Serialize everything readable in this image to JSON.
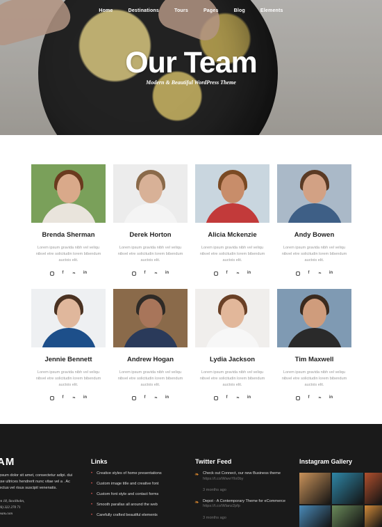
{
  "nav": [
    "Home",
    "Destinations",
    "Tours",
    "Pages",
    "Blog",
    "Elements"
  ],
  "hero": {
    "title": "Our Team",
    "subtitle": "Modern & Beautiful WordPress Theme"
  },
  "team": [
    {
      "name": "Brenda Sherman",
      "bio": "Lorem ipsum gravida nibh vel veliqu nibvel etre solicitudin lorem bibendum auctois elit.",
      "colors": {
        "bg": "#7aa05a",
        "skin": "#d9a98a",
        "hair": "#6a3a1e",
        "shirt": "#e9e4dc"
      }
    },
    {
      "name": "Derek Horton",
      "bio": "Lorem ipsum gravida nibh vel veliqu nibvel etre solicitudin lorem bibendum auctois elit.",
      "colors": {
        "bg": "#ececec",
        "skin": "#d8b197",
        "hair": "#8a6a4a",
        "shirt": "#f4f4f4"
      }
    },
    {
      "name": "Alicia Mckenzie",
      "bio": "Lorem ipsum gravida nibh vel veliqu nibvel etre solicitudin lorem bibendum auctois elit.",
      "colors": {
        "bg": "#c9d6df",
        "skin": "#c88d6a",
        "hair": "#7a4a24",
        "shirt": "#c23a3a"
      }
    },
    {
      "name": "Andy Bowen",
      "bio": "Lorem ipsum gravida nibh vel veliqu nibvel etre solicitudin lorem bibendum auctois elit.",
      "colors": {
        "bg": "#aab9c8",
        "skin": "#d2a184",
        "hair": "#5a3a24",
        "shirt": "#3e5f86"
      }
    },
    {
      "name": "Jennie Bennett",
      "bio": "Lorem ipsum gravida nibh vel veliqu nibvel etre solicitudin lorem bibendum auctois elit.",
      "colors": {
        "bg": "#eef0f2",
        "skin": "#e0b79c",
        "hair": "#4a3222",
        "shirt": "#1d4f8a"
      }
    },
    {
      "name": "Andrew Hogan",
      "bio": "Lorem ipsum gravida nibh vel veliqu nibvel etre solicitudin lorem bibendum auctois elit.",
      "colors": {
        "bg": "#8a6a4a",
        "skin": "#a8755a",
        "hair": "#2e2a26",
        "shirt": "#2a3a5a"
      }
    },
    {
      "name": "Lydia Jackson",
      "bio": "Lorem ipsum gravida nibh vel veliqu nibvel etre solicitudin lorem bibendum auctois elit.",
      "colors": {
        "bg": "#f0eeec",
        "skin": "#e2b79a",
        "hair": "#6a4026",
        "shirt": "#f7f7f7"
      }
    },
    {
      "name": "Tim Maxwell",
      "bio": "Lorem ipsum gravida nibh vel veliqu nibvel etre solicitudin lorem bibendum auctois elit.",
      "colors": {
        "bg": "#7f9ab3",
        "skin": "#cf9c7c",
        "hair": "#3a2a1e",
        "shirt": "#2a2a2a"
      }
    }
  ],
  "social_icons": [
    "instagram-icon",
    "facebook-icon",
    "twitter-icon",
    "linkedin-icon"
  ],
  "footer": {
    "brand": "AM",
    "about": "ipsum dolor sit amet, consectetur adipi. dui sse ultrices hendrerit nunc vitae vel a . Ac lectus vel risus suscipit venenatis.",
    "address_line1": "an 18, Stockholm,",
    "address_line2": "46) 322 270 71",
    "address_line3": "team.com",
    "links_title": "Links",
    "links": [
      "Creative styles of home presentations",
      "Custom image title and creative font",
      "Custom font style and contact forms",
      "Smooth parallax all around the web",
      "Carefully crafted beautiful elements"
    ],
    "twitter_title": "Twitter Feed",
    "tweets": [
      {
        "text": "Check out Connect, our new Business theme",
        "link": "https://t.co/WwvrYlo0by",
        "time": "3 months ago"
      },
      {
        "text": "Depot - A Contemporary Theme for eCommerce",
        "link": "https://t.co/Wlanz2pfp",
        "time": "3 months ago"
      }
    ],
    "instagram_title": "Instagram Gallery",
    "instagram_colors": [
      "#c9925a",
      "#2f86a6",
      "#b0502e",
      "#4a8ab8",
      "#6a8a5a",
      "#d08a3a"
    ]
  },
  "colors": {
    "footer_bg": "#1a1a1a",
    "bullet": "#d9534f",
    "twitter_bird": "#e08a2e"
  }
}
